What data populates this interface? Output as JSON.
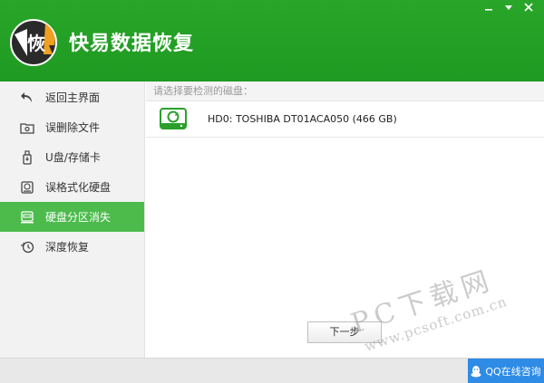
{
  "app": {
    "title": "快易数据恢复",
    "logo_char": "恢",
    "controls": [
      "minimize-icon",
      "settings-dropdown-icon",
      "close-icon"
    ]
  },
  "colors": {
    "brand_green": "#29a629",
    "active_green": "#4cbb4c",
    "qq_blue": "#2e8be6"
  },
  "sidebar": {
    "items": [
      {
        "label": "返回主界面",
        "icon": "back-arrow-icon"
      },
      {
        "label": "误删除文件",
        "icon": "folder-icon"
      },
      {
        "label": "U盘/存储卡",
        "icon": "usb-drive-icon"
      },
      {
        "label": "误格式化硬盘",
        "icon": "hard-drive-icon"
      },
      {
        "label": "硬盘分区消失",
        "icon": "partition-icon",
        "active": true
      },
      {
        "label": "深度恢复",
        "icon": "deep-recover-icon"
      }
    ]
  },
  "main": {
    "hint": "请选择要检测的磁盘：",
    "disks": [
      {
        "label": "HD0: TOSHIBA DT01ACA050 (466 GB)",
        "icon": "disk-drive-icon"
      }
    ],
    "next_label": "下一步"
  },
  "footer": {
    "qq_label": "QQ在线咨询"
  },
  "watermark": {
    "line1": "PC下载网",
    "line2": "www.pcsoft.com.cn"
  }
}
